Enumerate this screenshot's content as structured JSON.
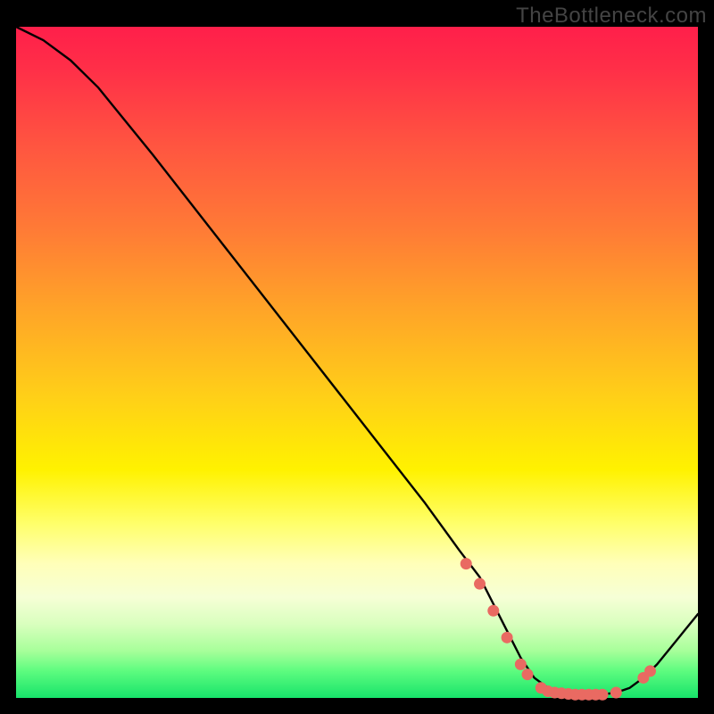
{
  "watermark": "TheBottleneck.com",
  "colors": {
    "frame_bg": "#000000",
    "curve_stroke": "#000000",
    "dot_fill": "#e96a62"
  },
  "chart_data": {
    "type": "line",
    "title": "",
    "xlabel": "",
    "ylabel": "",
    "xlim": [
      0,
      100
    ],
    "ylim": [
      0,
      100
    ],
    "series": [
      {
        "name": "bottleneck-curve",
        "x": [
          0,
          4,
          8,
          12,
          20,
          30,
          40,
          50,
          60,
          65,
          68,
          70,
          72,
          74,
          76,
          78,
          80,
          82,
          84,
          86,
          88,
          90,
          92,
          94,
          96,
          98,
          100
        ],
        "y": [
          100,
          98,
          95,
          91,
          81,
          68,
          55,
          42,
          29,
          22,
          18,
          14,
          10,
          6,
          3,
          1.5,
          0.8,
          0.5,
          0.5,
          0.5,
          0.8,
          1.5,
          3,
          5,
          7.5,
          10,
          12.5
        ]
      }
    ],
    "markers": {
      "name": "highlighted-points",
      "x": [
        66,
        68,
        70,
        72,
        74,
        75,
        77,
        78,
        79,
        80,
        81,
        82,
        83,
        84,
        85,
        86,
        88,
        92,
        93
      ],
      "y": [
        20,
        17,
        13,
        9,
        5,
        3.5,
        1.5,
        1,
        0.8,
        0.7,
        0.6,
        0.5,
        0.5,
        0.5,
        0.5,
        0.5,
        0.8,
        3,
        4
      ]
    }
  }
}
